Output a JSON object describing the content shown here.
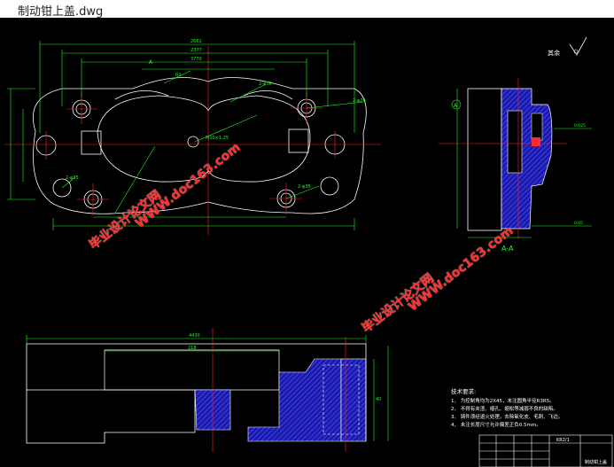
{
  "window": {
    "title": "制动钳上盖.dwg"
  },
  "drawing": {
    "roughness_label": "其余",
    "section_label": "A-A",
    "section_marker": "A",
    "dimensions": {
      "top1": "2661",
      "top2": "2377",
      "top3": "3770",
      "bottom_width": "4430",
      "bottom_inner": "218",
      "bottom_height": "40"
    },
    "annotations": {
      "hole_top": "2-φ36",
      "hole_right": "2-φ20",
      "hole_right2": "2-φ35",
      "hole_left": "2-φ35",
      "thread": "M10×1.25",
      "radius": "R1",
      "tol_right": "0.025",
      "tol_bottom": "0.05"
    },
    "notes": {
      "heading": "技术要求:",
      "items": [
        "1、 为控制角均为2X45，未注圆角半径R3R5。",
        "2、 不得有夹渣、缩孔、缩松等减弱不良的缺陷。",
        "3、 铸件须经退火处理，去除氧化皮、毛刺、飞边。",
        "4、 未注长度尺寸允许偏差正负0.5mm。"
      ]
    },
    "title_block": {
      "code": "KR2/1",
      "name": "制动钳上盖"
    }
  },
  "watermarks": [
    {
      "text": "WWW.doc163.com"
    },
    {
      "text": "毕业设计论文网"
    },
    {
      "text": "WWW.doc163.com"
    },
    {
      "text": "毕业设计论文网"
    }
  ],
  "colors": {
    "background": "#000000",
    "outline": "#ffffff",
    "dimension": "#00ff00",
    "center": "#ff0000",
    "hatch": "#3333ff",
    "annotation": "#00ffff",
    "watermark": "#ff2a2a"
  }
}
